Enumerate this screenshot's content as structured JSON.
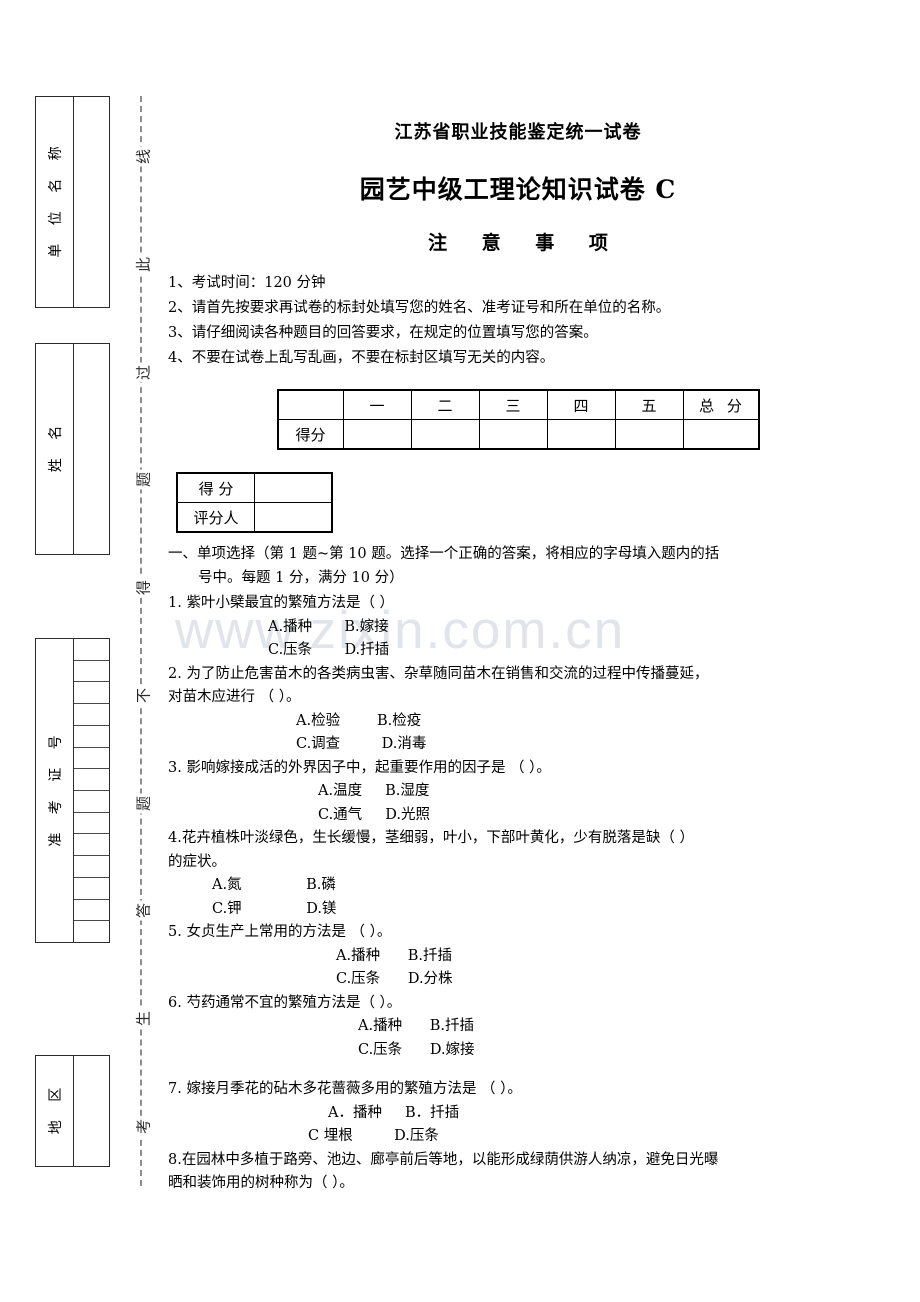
{
  "watermark": "www.zixin.com.cn",
  "seal_strip": {
    "boxes": [
      {
        "name": "unit-name",
        "label": "单 位 名 称",
        "type": "plain"
      },
      {
        "name": "examinee-name",
        "label": "姓    名",
        "type": "plain"
      },
      {
        "name": "admission-ticket-no",
        "label": "准 考 证 号",
        "type": "digit-grid",
        "cells": 14
      },
      {
        "name": "region",
        "label": "地    区",
        "type": "plain"
      }
    ],
    "seal_line_chars": [
      "线",
      "此",
      "过",
      "题",
      "得",
      "不",
      "题",
      "答",
      "生",
      "考"
    ],
    "seal_line_reading": "考生答题不得过此线"
  },
  "header": {
    "title_province": "江苏省职业技能鉴定统一试卷",
    "title_paper": "园艺中级工理论知识试卷 C",
    "title_notice": "注 意 事 项"
  },
  "notices": [
    "1、考试时间：120 分钟",
    "2、请首先按要求再试卷的标封处填写您的姓名、准考证号和所在单位的名称。",
    "3、请仔细阅读各种题目的回答要求，在规定的位置填写您的答案。",
    "4、不要在试卷上乱写乱画，不要在标封区填写无关的内容。"
  ],
  "score_table": {
    "lead_label": "得分",
    "columns": [
      "一",
      "二",
      "三",
      "四",
      "五",
      "总 分"
    ],
    "values": [
      "",
      "",
      "",
      "",
      "",
      ""
    ]
  },
  "grader_table": {
    "rows": [
      {
        "label": "得   分",
        "value": ""
      },
      {
        "label": "评分人",
        "value": ""
      }
    ]
  },
  "section": {
    "heading_line1": "一、单项选择（第 1 题~第 10 题。选择一个正确的答案，将相应的字母填入题内的括",
    "heading_line2": "号中。每题 1 分，满分 10 分）"
  },
  "questions": [
    {
      "number": "1",
      "stem": "1. 紫叶小檗最宜的繁殖方法是（      ）",
      "stem_cont": "",
      "rows": [
        {
          "text": "A.播种       B.嫁接",
          "indent": "ind-a"
        },
        {
          "text": "C.压条       D.扦插",
          "indent": "ind-a"
        }
      ]
    },
    {
      "number": "2",
      "stem": "2. 为了防止危害苗木的各类病虫害、杂草随同苗木在销售和交流的过程中传播蔓延，",
      "stem_cont": "对苗木应进行  （     ）。",
      "rows": [
        {
          "text": "A.检验        B.检疫",
          "indent": "ind-b"
        },
        {
          "text": "C.调查         D.消毒",
          "indent": "ind-b"
        }
      ]
    },
    {
      "number": "3",
      "stem": "3. 影响嫁接成活的外界因子中，起重要作用的因子是 （     ）。",
      "stem_cont": "",
      "rows": [
        {
          "text": "A.温度     B.湿度",
          "indent": "ind-c"
        },
        {
          "text": "C.通气     D.光照",
          "indent": "ind-c"
        }
      ]
    },
    {
      "number": "4",
      "stem": "4.花卉植株叶淡绿色，生长缓慢，茎细弱，叶小，下部叶黄化，少有脱落是缺（    ）",
      "stem_cont": "的症状。",
      "rows": [
        {
          "text": "A.氮              B.磷",
          "indent": "ind-e"
        },
        {
          "text": "C.钾              D.镁",
          "indent": "ind-e"
        }
      ]
    },
    {
      "number": "5",
      "stem": "5. 女贞生产上常用的方法是   （     ）。",
      "stem_cont": "",
      "rows": [
        {
          "text": "A.播种      B.扦插",
          "indent": "ind-d"
        },
        {
          "text": "C.压条      D.分株",
          "indent": "ind-d"
        }
      ]
    },
    {
      "number": "6",
      "stem": "6. 芍药通常不宜的繁殖方法是（     ）。",
      "stem_cont": "",
      "rows": [
        {
          "text": "A.播种      B.扦插",
          "indent": "ind-f"
        },
        {
          "text": "C.压条      D.嫁接",
          "indent": "ind-f"
        }
      ]
    },
    {
      "number": "7",
      "stem": "7. 嫁接月季花的砧木多花蔷薇多用的繁殖方法是  （   ）。",
      "stem_cont": "",
      "rows": [
        {
          "text": "A．播种     B．扦插",
          "indent": "ind-g"
        },
        {
          "text": "C 埋根         D.压条",
          "indent": "ind-h"
        }
      ]
    },
    {
      "number": "8",
      "stem": "8.在园林中多植于路旁、池边、廊亭前后等地，以能形成绿荫供游人纳凉，避免日光曝",
      "stem_cont": "晒和装饰用的树种称为（     ）。",
      "rows": []
    }
  ]
}
